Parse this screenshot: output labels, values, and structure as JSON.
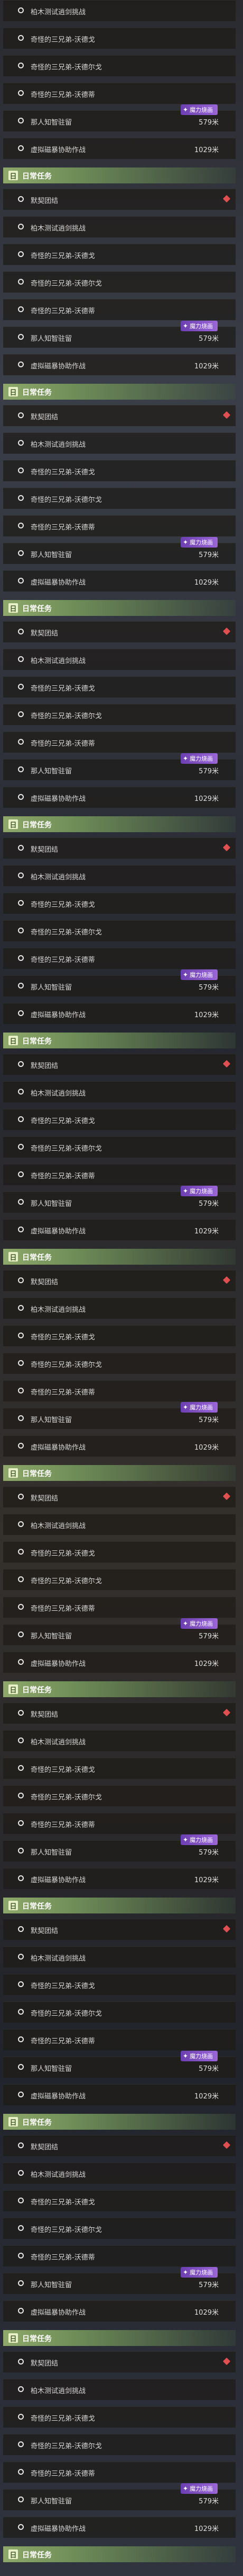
{
  "section_title": "日常任务",
  "section_icon": "日",
  "event_badge": "魔力烧画",
  "blocks": [
    {
      "header": true,
      "items": [
        {
          "label": "柏木测试逍剑挑战",
          "dist": "",
          "badge": false,
          "diamond": false
        },
        {
          "label": "奇怪的三兄弟-沃德戈",
          "dist": "",
          "badge": false,
          "diamond": false
        },
        {
          "label": "奇怪的三兄弟-沃德尔戈",
          "dist": "",
          "badge": false,
          "diamond": false
        },
        {
          "label": "奇怪的三兄弟-沃德蒂",
          "dist": "",
          "badge": false,
          "diamond": false
        },
        {
          "label": "那人知智驻留",
          "dist": "579米",
          "badge": true,
          "diamond": false
        },
        {
          "label": "虚拟磁暴协助作战",
          "dist": "1029米",
          "badge": false,
          "diamond": false
        },
        {
          "label": "默契团结",
          "dist": "",
          "badge": false,
          "diamond": true
        }
      ]
    }
  ]
}
